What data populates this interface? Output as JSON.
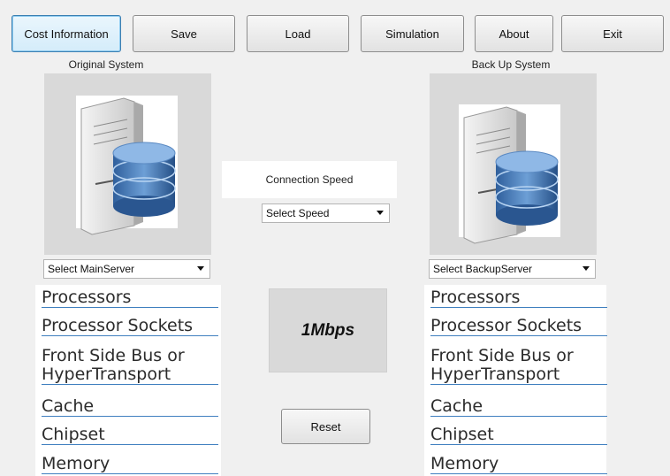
{
  "toolbar": {
    "cost_info": "Cost Information",
    "save": "Save",
    "load": "Load",
    "simulation": "Simulation",
    "about": "About",
    "exit": "Exit"
  },
  "original": {
    "caption": "Original System",
    "select": "Select MainServer",
    "specs": [
      "Processors",
      "Processor Sockets",
      "Front Side Bus or HyperTransport",
      "Cache",
      "Chipset",
      "Memory"
    ]
  },
  "backup": {
    "caption": "Back Up System",
    "select": "Select BackupServer",
    "specs": [
      "Processors",
      "Processor Sockets",
      "Front Side Bus or HyperTransport",
      "Cache",
      "Chipset",
      "Memory"
    ]
  },
  "connection": {
    "label": "Connection Speed",
    "select": "Select Speed",
    "speed_value": "1Mbps",
    "reset": "Reset"
  },
  "icons": {
    "server": "server-database-icon",
    "dropdown": "chevron-down-icon"
  }
}
